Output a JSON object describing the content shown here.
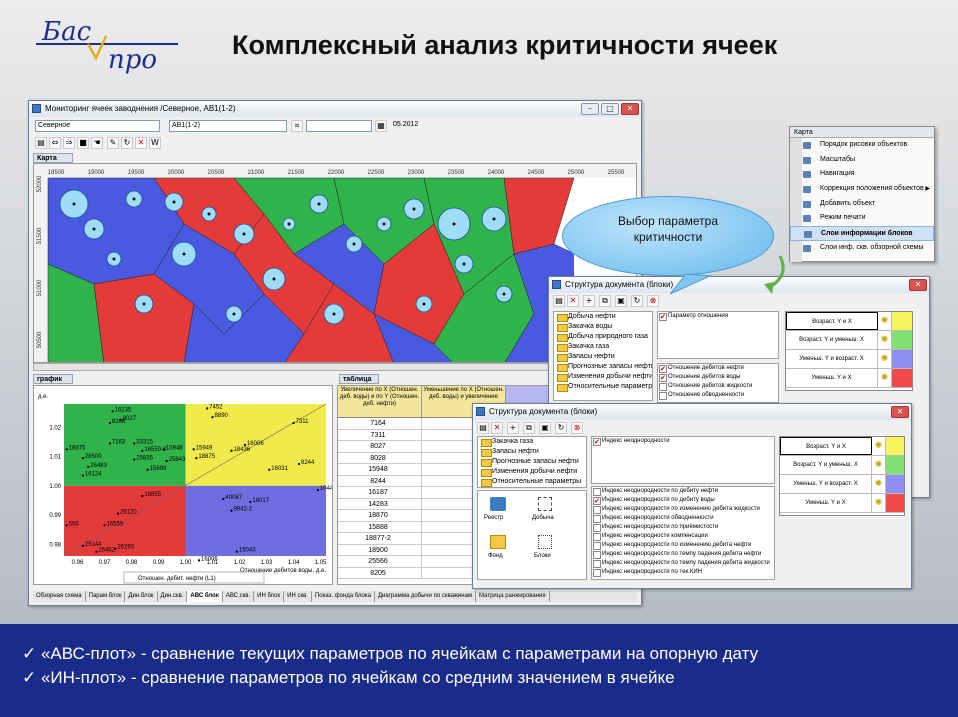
{
  "slide": {
    "title": "Комплексный анализ критичности ячеек",
    "logo_top": "Бас",
    "logo_bottom": "про",
    "bullets": [
      "«АВС-плот» - сравнение текущих параметров по ячейкам с параметрами на опорную дату",
      "«ИН-плот» - сравнение параметров по ячейкам со средним значением в ячейке"
    ],
    "callout": "Выбор параметра критичности"
  },
  "main_window": {
    "title": "Мониторинг ячеек заводнения /Северное, АВ1(1-2)",
    "field_value": "Северное",
    "layer_value": "АВ1(1-2)",
    "date_value": "05.2012",
    "map_header": "Карта",
    "graph_header": "график",
    "table_header": "таблица",
    "map_x_ticks": [
      "18500",
      "19000",
      "19500",
      "20000",
      "20500",
      "21000",
      "21500",
      "22000",
      "22500",
      "23000",
      "23500",
      "24000",
      "24500",
      "25000",
      "25500"
    ],
    "map_y_ticks": [
      "52000",
      "51500",
      "51000",
      "50500"
    ],
    "table_columns": [
      "Увеличение по X (Отношен. деб. воды) и по Y (Отношен. деб. нефти)",
      "Уменьшение по X (Отношен. деб. воды) и увеличение",
      "Увеличение"
    ],
    "table_rows": [
      [
        "7164",
        "7163"
      ],
      [
        "7311",
        "25552"
      ],
      [
        "8027",
        "18839"
      ],
      [
        "8028",
        "15884"
      ],
      [
        "15948",
        "15885"
      ],
      [
        "8244",
        "25559"
      ],
      [
        "16187",
        "18875"
      ],
      [
        "14283",
        "15892"
      ],
      [
        "18870",
        "18873"
      ],
      [
        "15888",
        "25616"
      ],
      [
        "18877-2",
        "15899"
      ],
      [
        "18900",
        "15898"
      ],
      [
        "25566",
        "16099"
      ],
      [
        "8205",
        "16141"
      ]
    ],
    "bottom_tabs": [
      "Обзорная схема",
      "Парам.блок",
      "Дин.блок",
      "Дин.скв.",
      "АВС блок",
      "АВС скв.",
      "ИН блок",
      "ИН скв.",
      "Показ. фонда блока",
      "Диаграмма добычи по скважинам",
      "Матрица ранжирования"
    ],
    "active_tab": "АВС блок",
    "legend_label": "Отношен. дебит. нефти (L1)"
  },
  "abc_plot": {
    "ylabel": "д.е.",
    "xlabel": "Отношение дебитов воды, д.е.",
    "x_ticks": [
      "0.96",
      "0.97",
      "0.98",
      "0.99",
      "1.00",
      "1.01",
      "1.02",
      "1.03",
      "1.04",
      "1.05"
    ],
    "y_ticks": [
      "1.02",
      "1.01",
      "1.00",
      "0.99",
      "0.98"
    ],
    "quadrants": {
      "top_left": "#2fb34a",
      "top_right": "#f0ea4a",
      "bottom_left": "#e53a3a",
      "bottom_right": "#6e6ee0"
    },
    "point_labels": [
      {
        "t": "16135",
        "x": 0.973,
        "y": 1.0255
      },
      {
        "t": "8206",
        "x": 0.972,
        "y": 1.0215
      },
      {
        "t": "8027",
        "x": 0.976,
        "y": 1.0225
      },
      {
        "t": "7163",
        "x": 0.972,
        "y": 1.0145
      },
      {
        "t": "33315",
        "x": 0.981,
        "y": 1.0145
      },
      {
        "t": "18875",
        "x": 0.956,
        "y": 1.0125
      },
      {
        "t": "28500",
        "x": 0.962,
        "y": 1.0095
      },
      {
        "t": "16550-2",
        "x": 0.984,
        "y": 1.012
      },
      {
        "t": "15948",
        "x": 0.992,
        "y": 1.0125
      },
      {
        "t": "26483",
        "x": 0.964,
        "y": 1.0065
      },
      {
        "t": "25835",
        "x": 0.981,
        "y": 1.009
      },
      {
        "t": "25843",
        "x": 0.993,
        "y": 1.0085
      },
      {
        "t": "16124",
        "x": 0.962,
        "y": 1.0035
      },
      {
        "t": "15899",
        "x": 0.986,
        "y": 1.0055
      },
      {
        "t": "7452",
        "x": 1.008,
        "y": 1.0265
      },
      {
        "t": "8890",
        "x": 1.01,
        "y": 1.0235
      },
      {
        "t": "7311",
        "x": 1.04,
        "y": 1.0215
      },
      {
        "t": "16006",
        "x": 1.022,
        "y": 1.014
      },
      {
        "t": "18436",
        "x": 1.017,
        "y": 1.012
      },
      {
        "t": "15949",
        "x": 1.003,
        "y": 1.0125
      },
      {
        "t": "18875",
        "x": 1.004,
        "y": 1.0095
      },
      {
        "t": "16031",
        "x": 1.031,
        "y": 1.0055
      },
      {
        "t": "8244",
        "x": 1.042,
        "y": 1.0075
      },
      {
        "t": "18855",
        "x": 0.984,
        "y": 0.9965
      },
      {
        "t": "26120",
        "x": 0.975,
        "y": 0.9905
      },
      {
        "t": "16559",
        "x": 0.97,
        "y": 0.9865
      },
      {
        "t": "556",
        "x": 0.956,
        "y": 0.9865
      },
      {
        "t": "25144",
        "x": 0.962,
        "y": 0.9795
      },
      {
        "t": "26482",
        "x": 0.967,
        "y": 0.9775
      },
      {
        "t": "26293",
        "x": 0.974,
        "y": 0.9785
      },
      {
        "t": "16017",
        "x": 1.024,
        "y": 0.9945
      },
      {
        "t": "15043",
        "x": 1.019,
        "y": 0.9775
      },
      {
        "t": "16006",
        "x": 1.005,
        "y": 0.9745
      },
      {
        "t": "40087",
        "x": 1.014,
        "y": 0.9955
      },
      {
        "t": "9942-2",
        "x": 1.017,
        "y": 0.9915
      },
      {
        "t": "1044",
        "x": 1.049,
        "y": 0.9985
      }
    ]
  },
  "doc_window_1": {
    "title": "Структура документа (блоки)",
    "tree": [
      "Добыча нефти",
      "Закачка воды",
      "Добыча природного газа",
      "Закачка газа",
      "Запасы нефти",
      "Прогнозные запасы нефти",
      "Изменения добычи нефти",
      "Относительные параметры"
    ],
    "param_selected": "Параметр отношения",
    "params": [
      {
        "label": "Отношение дебитов нефти",
        "checked": true
      },
      {
        "label": "Отношение дебитов воды",
        "checked": true
      },
      {
        "label": "Отношение дебитов жидкости",
        "checked": false
      },
      {
        "label": "Отношение обводненности",
        "checked": false
      }
    ],
    "criteria": [
      "Возраст. Y и X",
      "Возраст. Y и уменьш. X",
      "Уменьш. Y и возраст. X",
      "Уменьш. Y и X"
    ],
    "criteria_colors": [
      "#f7f35c",
      "#7fe06f",
      "#8f8ff2",
      "#f04a4a"
    ]
  },
  "doc_window_2": {
    "title": "Структура документа (блоки)",
    "tree": [
      "Закачка газа",
      "Запасы нефти",
      "Прогнозные запасы нефти",
      "Изменения добычи нефти",
      "Относительные параметры"
    ],
    "param_selected": "Индекс неоднородности",
    "icons": [
      "Реестр",
      "Добыча",
      "Фонд",
      "Блоки"
    ],
    "params": [
      {
        "label": "Индекс неоднородности по дебиту нефти",
        "checked": false
      },
      {
        "label": "Индекс неоднородности по дебиту воды",
        "checked": true
      },
      {
        "label": "Индекс неоднородности по изменению дебита жидкости",
        "checked": false
      },
      {
        "label": "Индекс неоднородности обводненности",
        "checked": false
      },
      {
        "label": "Индекс неоднородности по приёмистости",
        "checked": false
      },
      {
        "label": "Индекс неоднородности компенсации",
        "checked": false
      },
      {
        "label": "Индекс неоднородности по изменению дебита нефти",
        "checked": false
      },
      {
        "label": "Индекс неоднородности по темпу падения дебита нефти",
        "checked": false
      },
      {
        "label": "Индекс неоднородности по темпу падения дебита жидкости",
        "checked": false
      },
      {
        "label": "Индекс неоднородности по тек.КИН",
        "checked": false
      }
    ],
    "criteria": [
      "Возраст. Y и X",
      "Возраст. Y и уменьш. X",
      "Уменьш. Y и возраст. X",
      "Уменьш. Y и X"
    ],
    "criteria_colors": [
      "#f7f35c",
      "#7fe06f",
      "#8f8ff2",
      "#f04a4a"
    ]
  },
  "context_menu": {
    "header": "Карта",
    "items": [
      {
        "label": "Порядок рисовки объектов",
        "highlight": false,
        "arrow": false
      },
      {
        "label": "Масштабы",
        "highlight": false,
        "arrow": false
      },
      {
        "label": "Навигация",
        "highlight": false,
        "arrow": false
      },
      {
        "label": "Коррекция положения объектов",
        "highlight": false,
        "arrow": true
      },
      {
        "label": "Добавить объект",
        "highlight": false,
        "arrow": false
      },
      {
        "label": "Режим печати",
        "highlight": false,
        "arrow": false
      },
      {
        "label": "Слои информации блоков",
        "highlight": true,
        "arrow": false
      },
      {
        "label": "Слои инф. скв. обзорной схемы",
        "highlight": false,
        "arrow": false
      }
    ]
  }
}
